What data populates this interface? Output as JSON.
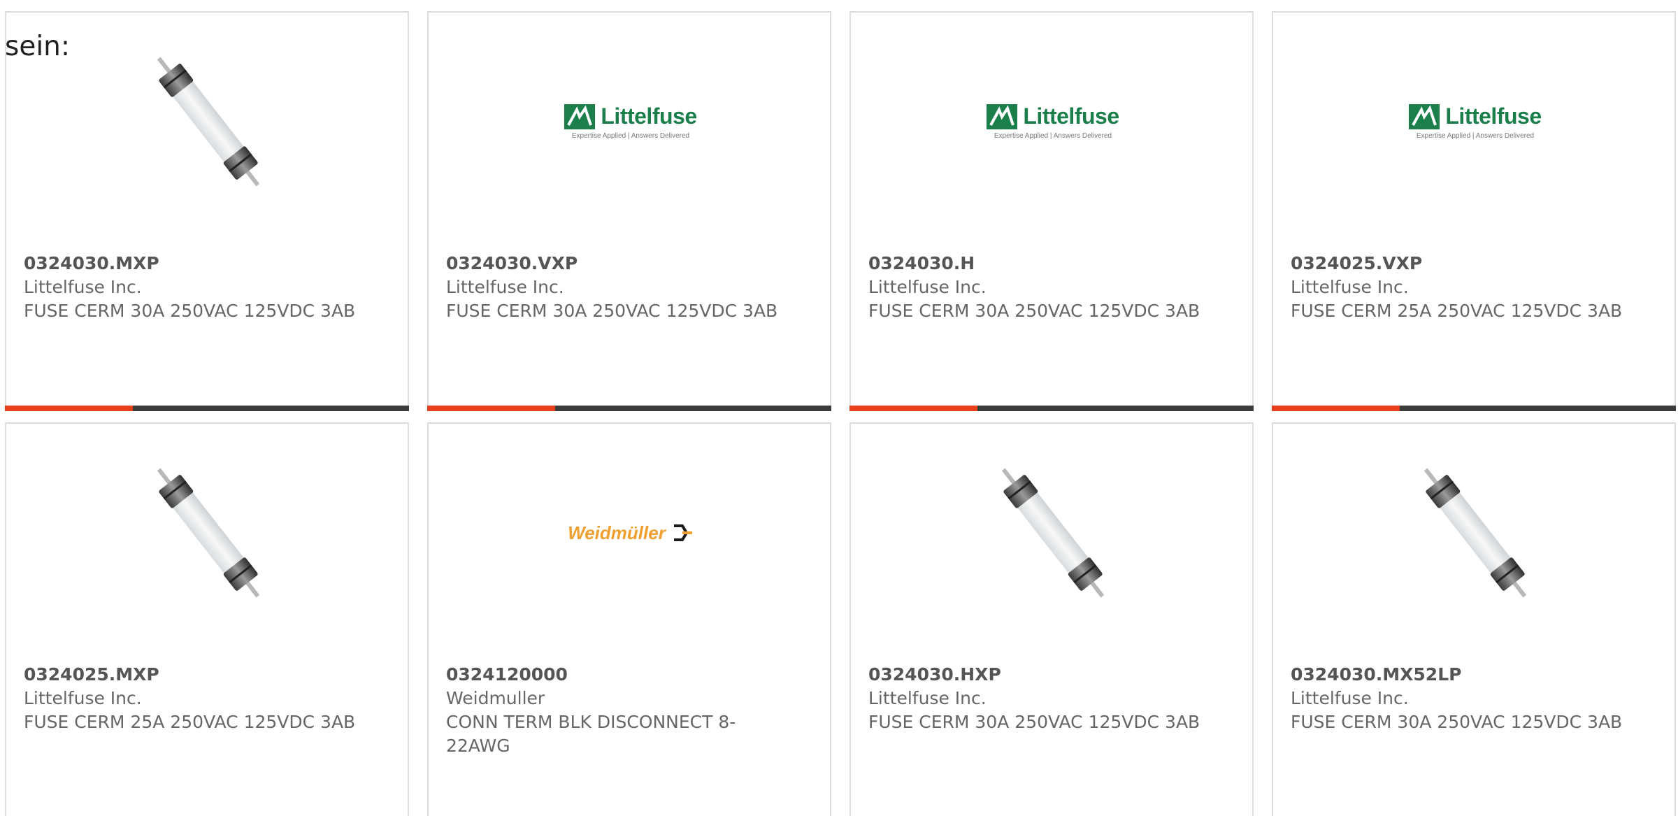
{
  "intro_text": "sein:",
  "colors": {
    "accent": "#e8401c",
    "bar_dark": "#3c3c3c",
    "littelfuse_green": "#1a7f4a",
    "weidmuller_orange": "#f0a030"
  },
  "logos": {
    "littelfuse": {
      "name": "Littelfuse",
      "tagline": "Expertise Applied | Answers Delivered"
    },
    "weidmuller": {
      "name": "Weidmüller"
    }
  },
  "products": [
    {
      "part_number": "0324030.MXP",
      "manufacturer": "Littelfuse Inc.",
      "description": "FUSE CERM 30A 250VAC 125VDC 3AB",
      "image": "fuse-photo",
      "has_bar": true
    },
    {
      "part_number": "0324030.VXP",
      "manufacturer": "Littelfuse Inc.",
      "description": "FUSE CERM 30A 250VAC 125VDC 3AB",
      "image": "littelfuse-logo",
      "has_bar": true
    },
    {
      "part_number": "0324030.H",
      "manufacturer": "Littelfuse Inc.",
      "description": "FUSE CERM 30A 250VAC 125VDC 3AB",
      "image": "littelfuse-logo",
      "has_bar": true
    },
    {
      "part_number": "0324025.VXP",
      "manufacturer": "Littelfuse Inc.",
      "description": "FUSE CERM 25A 250VAC 125VDC 3AB",
      "image": "littelfuse-logo",
      "has_bar": true
    },
    {
      "part_number": "0324025.MXP",
      "manufacturer": "Littelfuse Inc.",
      "description": "FUSE CERM 25A 250VAC 125VDC 3AB",
      "image": "fuse-photo",
      "has_bar": false
    },
    {
      "part_number": "0324120000",
      "manufacturer": "Weidmuller",
      "description": "CONN TERM BLK DISCONNECT 8-22AWG",
      "image": "weidmuller-logo",
      "has_bar": false
    },
    {
      "part_number": "0324030.HXP",
      "manufacturer": "Littelfuse Inc.",
      "description": "FUSE CERM 30A 250VAC 125VDC 3AB",
      "image": "fuse-photo",
      "has_bar": false
    },
    {
      "part_number": "0324030.MX52LP",
      "manufacturer": "Littelfuse Inc.",
      "description": "FUSE CERM 30A 250VAC 125VDC 3AB",
      "image": "fuse-photo",
      "has_bar": false
    }
  ]
}
